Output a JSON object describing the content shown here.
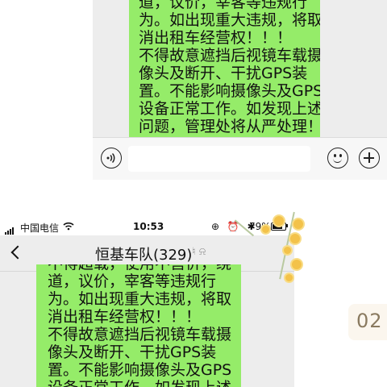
{
  "top_screenshot": {
    "message_lines": [
      "道，议价，宰客等违规行",
      "为。如出现重大违规，将取",
      "消出租车经营权！！！",
      "不得故意遮挡后视镜车载摄",
      "像头及断开、干扰GPS装",
      "置。不能影响摄像头及GPS",
      "设备正常工作。如发现上述",
      "问题，管理处将从严处理！"
    ],
    "input_bar": {
      "input_value": ""
    }
  },
  "bottom_screenshot": {
    "status_bar": {
      "carrier": "中国电信",
      "time": "10:53",
      "battery_percent": "79%",
      "battery_level": 0.79
    },
    "nav": {
      "title": "恒基车队(329)"
    },
    "message_lines": [
      "不得超载，使用不营价，绕",
      "道，议价，宰客等违规行",
      "为。如出现重大违规，将取",
      "消出租车经营权！！！",
      "不得故意遮挡后视镜车载摄",
      "像头及断开、干扰GPS装",
      "置。不能影响摄像头及GPS",
      "设备正常工作。如发现上述"
    ]
  },
  "page_number": "02",
  "colors": {
    "bubble_green": "#95ec69",
    "chat_background": "#ededed",
    "flower_yellow": "#f3c24a"
  },
  "icons": [
    "voice-icon",
    "emoji-icon",
    "plus-icon",
    "back-chevron-icon",
    "wifi-icon",
    "battery-icon"
  ]
}
